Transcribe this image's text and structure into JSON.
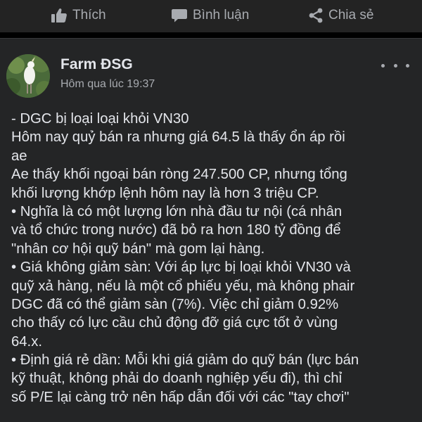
{
  "actions": {
    "like_label": "Thích",
    "comment_label": "Bình luận",
    "share_label": "Chia sẻ"
  },
  "post": {
    "author": "Farm ĐSG",
    "time": "Hôm qua lúc 19:37",
    "lines": [
      "- DGC bị loại loại khỏi VN30",
      "Hôm nay quỷ bán ra nhưng giá 64.5 là thấy ổn áp rồi",
      "ae",
      "Ae thấy khối ngoại bán ròng 247.500 CP, nhưng tổng",
      "khối lượng khớp lệnh hôm nay là hơn 3 triệu CP.",
      "•  Nghĩa là có một lượng lớn nhà đầu tư nội (cá nhân",
      "và tổ chức trong nước) đã bỏ ra hơn 180 tỷ đồng để",
      "\"nhân cơ hội quỹ bán\" mà gom lại hàng.",
      "• Giá không giảm sàn: Với áp lực bị loại khỏi VN30 và",
      "quỹ xả hàng, nếu là một cổ phiếu yếu, mà không phair",
      "DGC đã có thể giảm sàn (7%). Việc chỉ giảm 0.92%",
      "cho thấy có lực cầu chủ động đỡ giá cực tốt ở vùng",
      "64.x.",
      "• Định giá rẻ dần: Mỗi khi giá giảm do quỹ bán (lực bán",
      "kỹ thuật, không phải do doanh nghiệp yếu đi), thì chỉ",
      "số P/E lại càng trở nên hấp dẫn đối với các \"tay chơi\""
    ]
  },
  "icons": {
    "like": "thumbs-up-icon",
    "comment": "comment-icon",
    "share": "share-icon",
    "more": "more-dots-icon"
  },
  "colors": {
    "background": "#000000",
    "action_bar": "#232323",
    "card": "#242526",
    "primary_text": "#e4e6eb",
    "secondary_text": "#a8abb0"
  }
}
